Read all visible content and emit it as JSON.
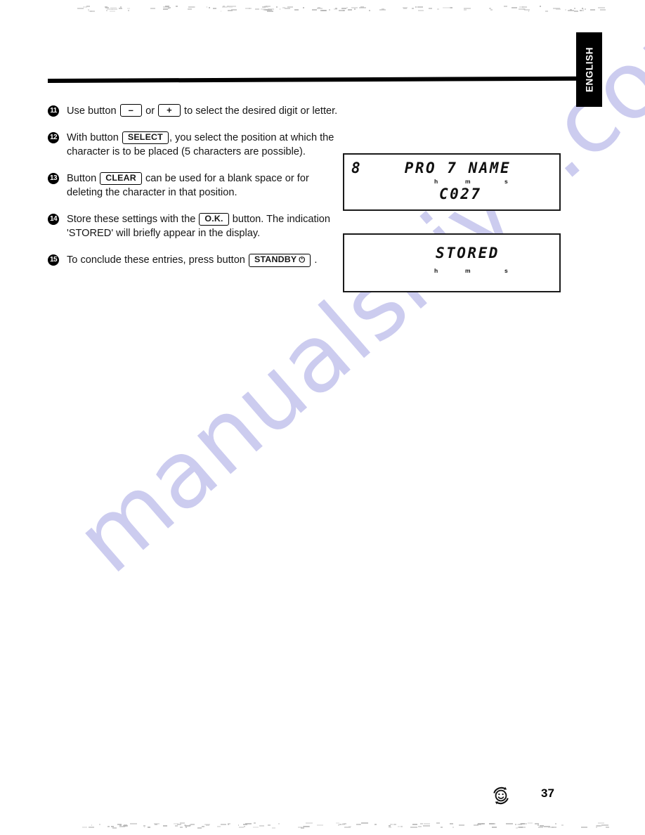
{
  "page": {
    "number": "37",
    "language_tab": "ENGLISH",
    "watermark": "manualshive.com",
    "logo_icon": "recycle-smiley-icon"
  },
  "instructions": [
    {
      "number": "11",
      "parts": [
        {
          "type": "text",
          "value": "Use button "
        },
        {
          "type": "button",
          "value": "–"
        },
        {
          "type": "text",
          "value": " or "
        },
        {
          "type": "button",
          "value": "+"
        },
        {
          "type": "text",
          "value": " to select the desired digit or letter."
        }
      ]
    },
    {
      "number": "12",
      "parts": [
        {
          "type": "text",
          "value": "With button "
        },
        {
          "type": "button",
          "value": "SELECT"
        },
        {
          "type": "text",
          "value": ", you select the position at which the character is to be placed (5 characters are possible)."
        }
      ]
    },
    {
      "number": "13",
      "parts": [
        {
          "type": "text",
          "value": "Button "
        },
        {
          "type": "button",
          "value": "CLEAR"
        },
        {
          "type": "text",
          "value": " can be used for a blank space or for deleting the character in that position."
        }
      ]
    },
    {
      "number": "14",
      "parts": [
        {
          "type": "text",
          "value": "Store these settings with the "
        },
        {
          "type": "button",
          "value": "O.K."
        },
        {
          "type": "text",
          "value": " button. The indication 'STORED' will briefly appear in the display."
        }
      ]
    },
    {
      "number": "15",
      "parts": [
        {
          "type": "text",
          "value": "To conclude these entries, press button "
        },
        {
          "type": "button",
          "value": "STANDBY",
          "glyph": "⏻"
        },
        {
          "type": "text",
          "value": " ."
        }
      ]
    }
  ],
  "displays": [
    {
      "name": "program-name-display",
      "top_line": "8    PRO 7 NAME",
      "bottom_line": "C027",
      "markers": {
        "h": "h",
        "m": "m",
        "s": "s"
      }
    },
    {
      "name": "stored-confirmation-display",
      "main_line": "STORED",
      "markers": {
        "h": "h",
        "m": "m",
        "s": "s"
      }
    }
  ]
}
